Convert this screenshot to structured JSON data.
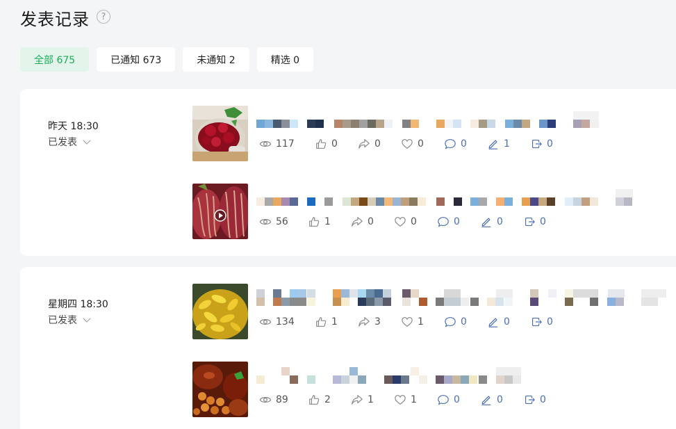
{
  "page": {
    "title": "发表记录"
  },
  "tabs": [
    {
      "label": "全部 675"
    },
    {
      "label": "已通知 673"
    },
    {
      "label": "未通知 2"
    },
    {
      "label": "精选 0"
    }
  ],
  "groups": [
    {
      "date": "昨天 18:30",
      "status": "已发表",
      "posts": [
        {
          "thumb": "cherry-jam",
          "views": "117",
          "likes": "0",
          "shares": "0",
          "favs": "0",
          "comments": "0",
          "edits": "1",
          "exports": "0"
        },
        {
          "thumb": "pitaya-video",
          "views": "56",
          "likes": "1",
          "shares": "0",
          "favs": "0",
          "comments": "0",
          "edits": "0",
          "exports": "0"
        }
      ]
    },
    {
      "date": "星期四 18:30",
      "status": "已发表",
      "posts": [
        {
          "thumb": "yellow-peppers",
          "views": "134",
          "likes": "1",
          "shares": "3",
          "favs": "1",
          "comments": "0",
          "edits": "0",
          "exports": "0"
        },
        {
          "thumb": "braised-meat",
          "views": "89",
          "likes": "2",
          "shares": "1",
          "favs": "1",
          "comments": "0",
          "edits": "0",
          "exports": "0"
        }
      ]
    }
  ],
  "colors": {
    "accent": "#1aad5a",
    "accent_bg": "#e3f4ea",
    "stat_blue": "#4a6fb5"
  }
}
